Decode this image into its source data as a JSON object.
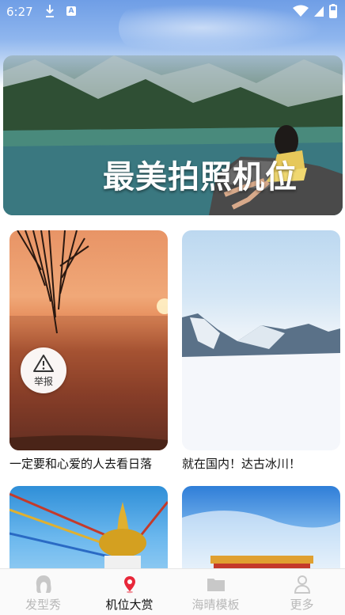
{
  "status_bar": {
    "time": "6:27",
    "icons": [
      "download-icon",
      "a-icon",
      "wifi-icon",
      "signal-icon",
      "battery-icon"
    ]
  },
  "banner": {
    "title": "最美拍照机位"
  },
  "cards": [
    {
      "caption": "一定要和心爱的人去看日落"
    },
    {
      "caption": "就在国内！达古冰川！"
    },
    {
      "caption": ""
    },
    {
      "caption": ""
    }
  ],
  "report": {
    "label": "举报"
  },
  "tabs": [
    {
      "label": "发型秀",
      "icon": "hair-icon",
      "active": false
    },
    {
      "label": "机位大赏",
      "icon": "location-pin-icon",
      "active": true
    },
    {
      "label": "海晴模板",
      "icon": "folder-icon",
      "active": false
    },
    {
      "label": "更多",
      "icon": "user-icon",
      "active": false
    }
  ],
  "colors": {
    "accent": "#e8283a",
    "inactive": "#b8b8b8"
  }
}
